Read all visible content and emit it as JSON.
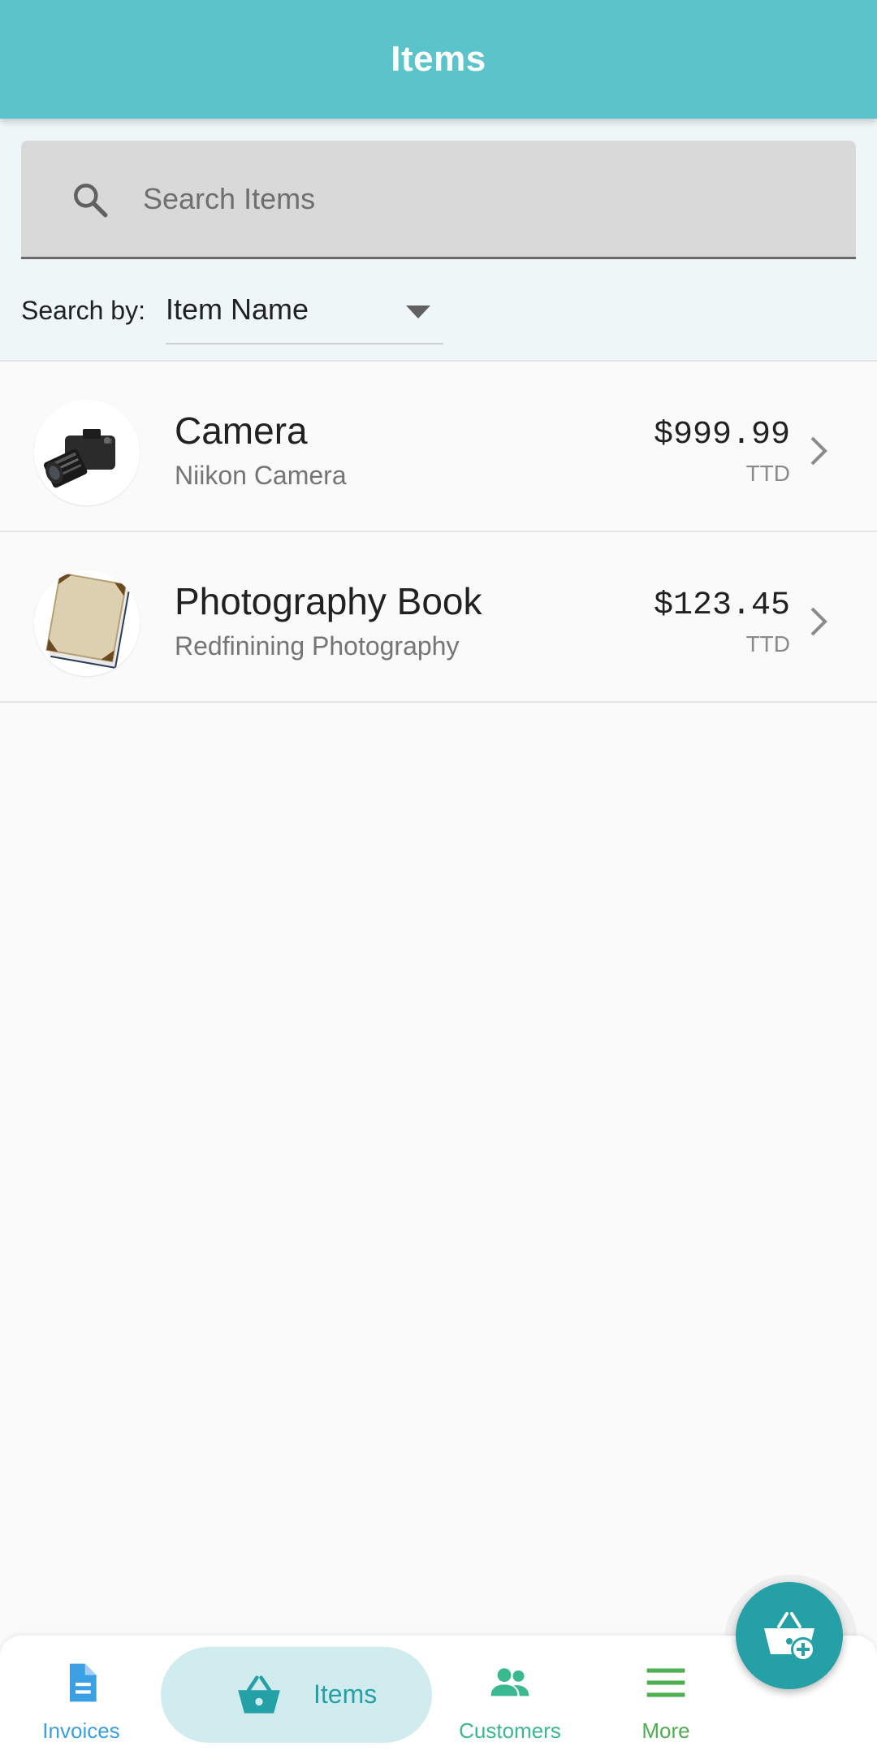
{
  "appbar": {
    "title": "Items"
  },
  "search": {
    "placeholder": "Search Items",
    "value": ""
  },
  "search_by": {
    "label": "Search by:",
    "selected": "Item Name"
  },
  "items": [
    {
      "name": "Camera",
      "description": "Niikon Camera",
      "price": "$999.99",
      "currency": "TTD",
      "image_icon": "camera-icon"
    },
    {
      "name": "Photography Book",
      "description": "Redfinining Photography",
      "price": "$123.45",
      "currency": "TTD",
      "image_icon": "book-icon"
    }
  ],
  "fab": {
    "icon": "add-to-basket-icon"
  },
  "bottom_nav": {
    "invoices": {
      "label": "Invoices",
      "icon": "document-icon",
      "color": "#3b9fe3"
    },
    "items": {
      "label": "Items",
      "icon": "basket-icon",
      "color": "#26a0a7",
      "active": true
    },
    "customers": {
      "label": "Customers",
      "icon": "people-icon",
      "color": "#3ab890"
    },
    "more": {
      "label": "More",
      "icon": "menu-icon",
      "color": "#4caf50"
    }
  },
  "colors": {
    "primary": "#5bc3ca",
    "accent": "#26a0a7"
  }
}
